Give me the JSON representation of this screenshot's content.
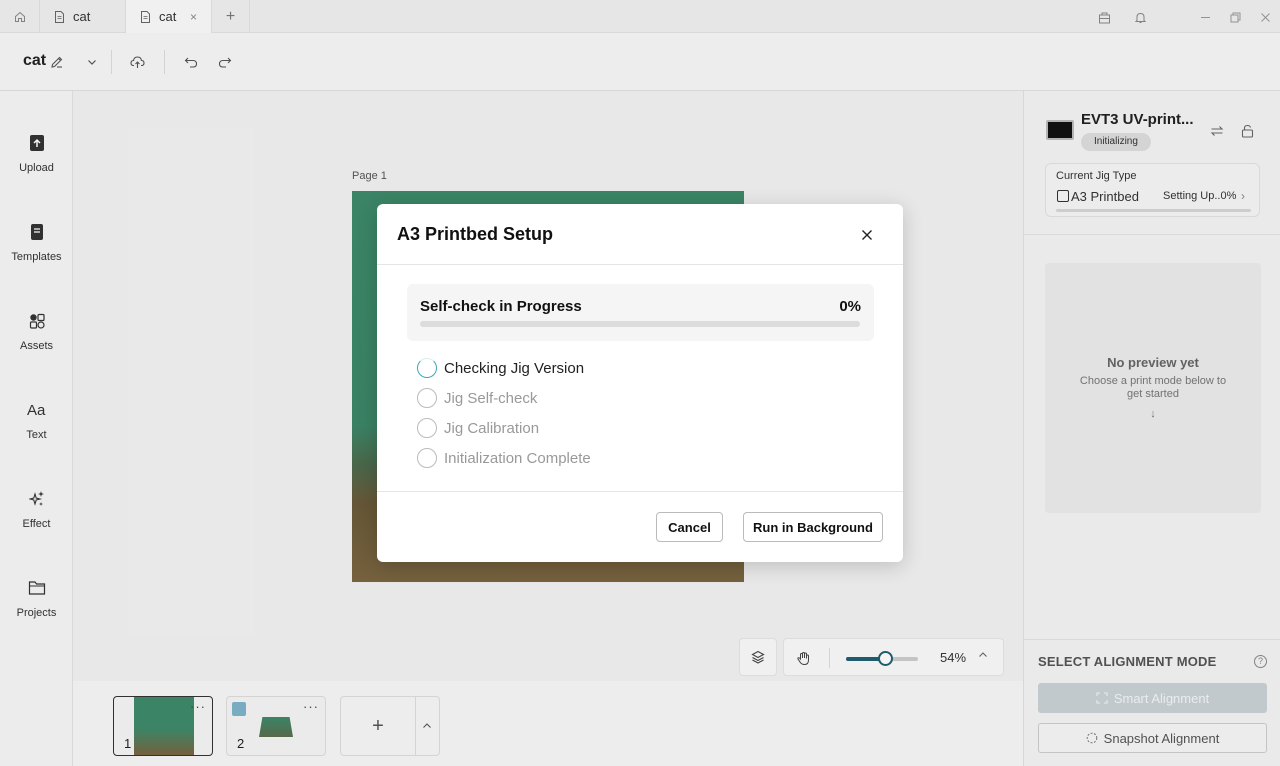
{
  "tabs": [
    {
      "label": "cat",
      "active": false
    },
    {
      "label": "cat",
      "active": true,
      "close": "×"
    }
  ],
  "tab_add": "+",
  "toolbar": {
    "doc_title": "cat"
  },
  "sidebar": {
    "items": [
      {
        "label": "Upload",
        "icon": "upload-icon"
      },
      {
        "label": "Templates",
        "icon": "templates-icon"
      },
      {
        "label": "Assets",
        "icon": "assets-icon"
      },
      {
        "label": "Text",
        "icon": "text-icon"
      },
      {
        "label": "Effect",
        "icon": "effect-icon"
      },
      {
        "label": "Projects",
        "icon": "folder-icon"
      }
    ]
  },
  "canvas": {
    "page_label": "Page 1"
  },
  "thumbnails": [
    {
      "number": "1",
      "menu": "···",
      "selected": true
    },
    {
      "number": "2",
      "menu": "···",
      "selected": false
    }
  ],
  "add_page": "+",
  "zoom": {
    "percent_label": "54%",
    "value": 0.54
  },
  "device": {
    "name": "EVT3 UV-print...",
    "status": "Initializing",
    "jig_title": "Current Jig Type",
    "jig_name": "A3 Printbed",
    "jig_status": "Setting Up..0%",
    "jig_progress": 0
  },
  "preview": {
    "title": "No preview yet",
    "subtitle": "Choose a print mode below to get started",
    "arrow": "↓"
  },
  "alignment": {
    "title": "SELECT ALIGNMENT MODE",
    "help": "?",
    "smart": "Smart Alignment",
    "snapshot": "Snapshot Alignment"
  },
  "modal": {
    "title": "A3 Printbed Setup",
    "progress_title": "Self-check in Progress",
    "progress_pct": "0%",
    "progress_value": 0,
    "steps": [
      {
        "label": "Checking Jig Version",
        "state": "active"
      },
      {
        "label": "Jig Self-check",
        "state": "pending"
      },
      {
        "label": "Jig Calibration",
        "state": "pending"
      },
      {
        "label": "Initialization Complete",
        "state": "pending"
      }
    ],
    "cancel": "Cancel",
    "run_background": "Run in Background"
  },
  "colors": {
    "accent": "#1f5f73",
    "spinner": "#3aa6b9"
  }
}
